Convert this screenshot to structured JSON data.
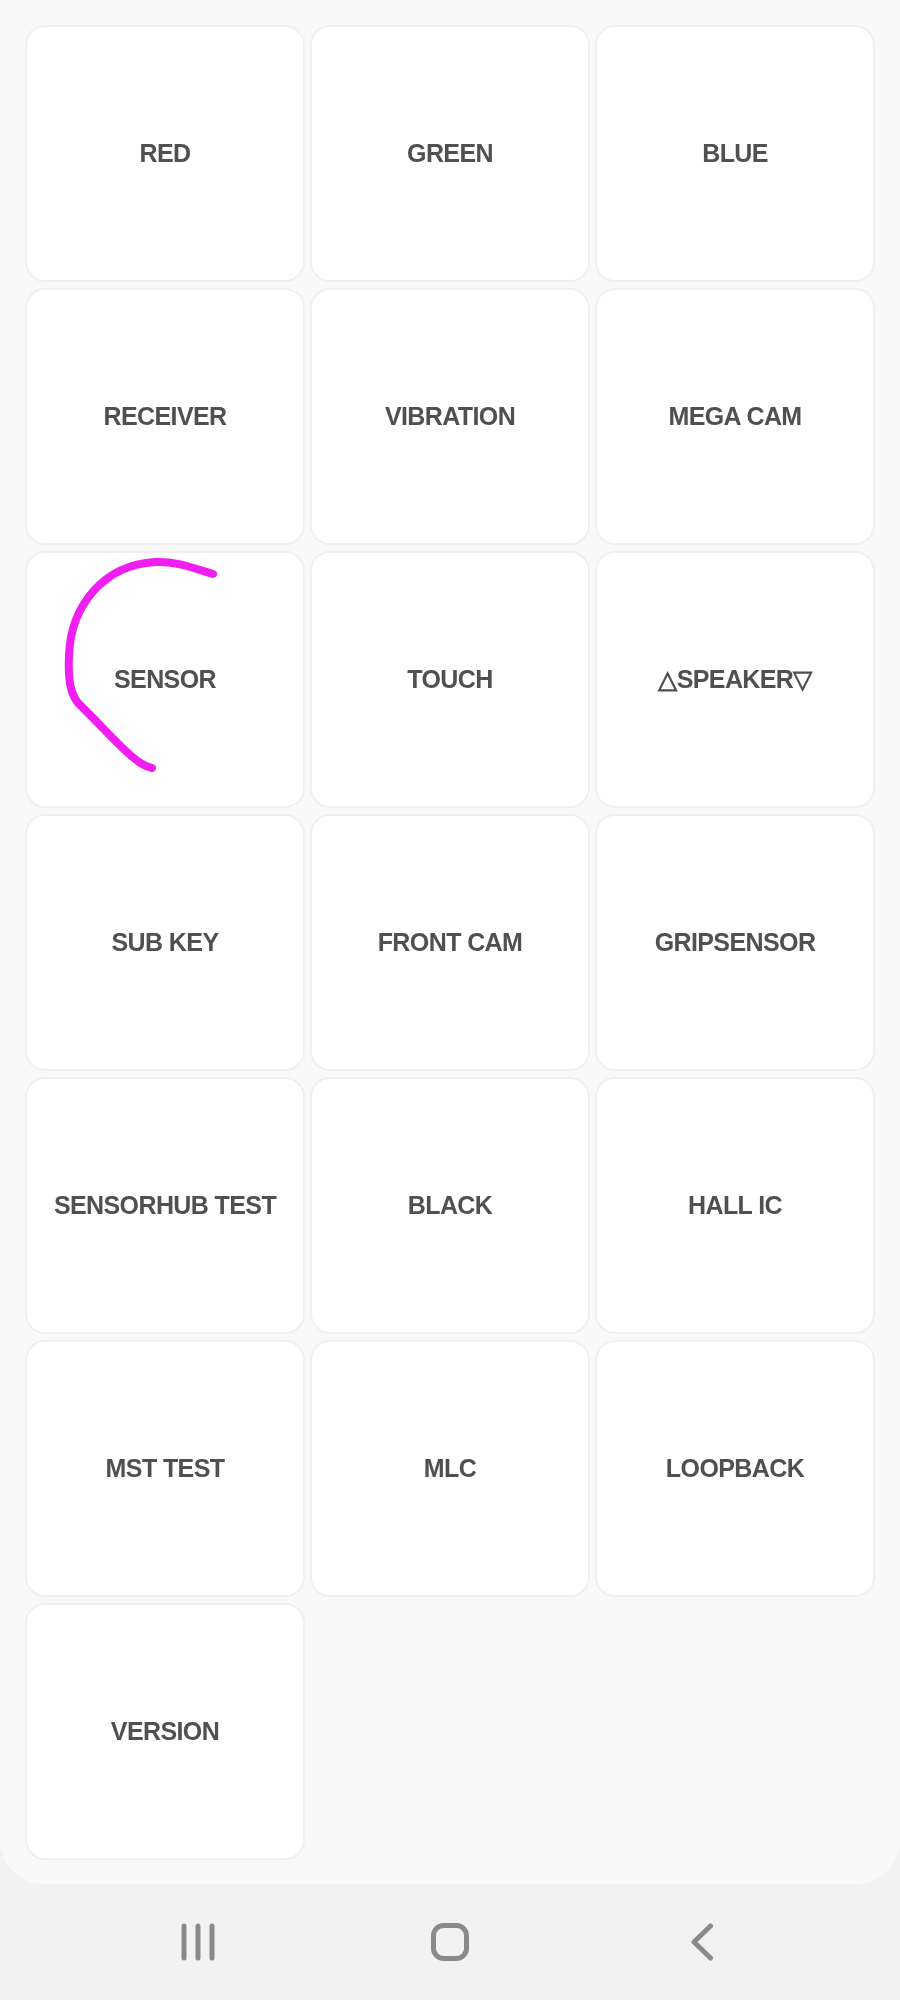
{
  "tiles": [
    {
      "label": "RED"
    },
    {
      "label": "GREEN"
    },
    {
      "label": "BLUE"
    },
    {
      "label": "RECEIVER"
    },
    {
      "label": "VIBRATION"
    },
    {
      "label": "MEGA CAM"
    },
    {
      "label": "SENSOR"
    },
    {
      "label": "TOUCH"
    },
    {
      "label": "△SPEAKER▽"
    },
    {
      "label": "SUB KEY"
    },
    {
      "label": "FRONT CAM"
    },
    {
      "label": "GRIPSENSOR"
    },
    {
      "label": "SENSORHUB TEST"
    },
    {
      "label": "BLACK"
    },
    {
      "label": "HALL IC"
    },
    {
      "label": "MST TEST"
    },
    {
      "label": "MLC"
    },
    {
      "label": "LOOPBACK"
    },
    {
      "label": "VERSION"
    }
  ],
  "nav_bar": [
    {
      "kind": "recents"
    },
    {
      "kind": "home"
    },
    {
      "kind": "back"
    }
  ]
}
